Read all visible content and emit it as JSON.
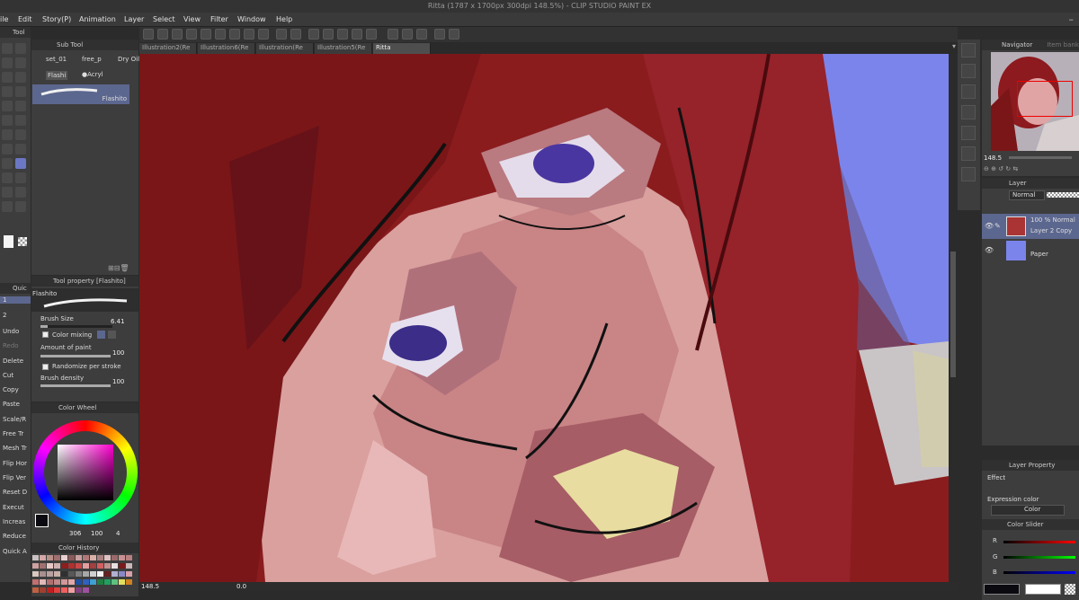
{
  "window_title": "Ritta (1787 x 1700px 300dpi 148.5%) - CLIP STUDIO PAINT EX",
  "menu": [
    "ile",
    "Edit",
    "Story(P)",
    "Animation",
    "Layer",
    "Select",
    "View",
    "Filter",
    "Window",
    "Help"
  ],
  "tool_panel": {
    "tab": "Tool"
  },
  "subtool_panel": {
    "tab": "Sub Tool",
    "groups": [
      "set_01",
      "free_p",
      "Dry Oil"
    ],
    "tabs": [
      "Flashi",
      "●Acryl"
    ],
    "active_brush": "Flashito"
  },
  "canvas_tabs": [
    "Illustration2(Re",
    "Illustration6(Re",
    "Illustration(Re",
    "Illustration5(Re",
    "Ritta"
  ],
  "active_tab": "Ritta",
  "quick_tab": "Quic",
  "quick_slots": [
    "1",
    "2"
  ],
  "commands": [
    "Undo",
    "Redo",
    "Delete",
    "Cut",
    "Copy",
    "Paste",
    "Scale/R",
    "Free Tr",
    "Mesh Tr",
    "Flip Hor",
    "Flip Ver",
    "Reset D",
    "Execut",
    "Increas",
    "Reduce",
    "Quick A"
  ],
  "tool_property": {
    "title": "Tool property [Flashito]",
    "brush_name": "Flashito",
    "brush_size_label": "Brush Size",
    "brush_size_value": "6.41",
    "color_mixing_label": "Color mixing",
    "amount_label": "Amount of paint",
    "amount_value": "100",
    "randomize_label": "Randomize per stroke",
    "density_label": "Brush density",
    "density_value": "100"
  },
  "color_wheel": {
    "title": "Color Wheel",
    "h": "306",
    "s": "100",
    "v": "4",
    "hue_color": "#ff00d0"
  },
  "color_history": {
    "title": "Color History",
    "swatches": [
      "#c9c2c0",
      "#d4a8a8",
      "#b8908a",
      "#a06e6e",
      "#e8d0d0",
      "#8a5a5a",
      "#c8a0a0",
      "#b07878",
      "#d8b0a8",
      "#a88080",
      "#e0c0c0",
      "#9a6a6a",
      "#c89090",
      "#b88080",
      "#d0a0a0",
      "#a07070",
      "#e8c8c8",
      "#d0b0b0",
      "#8a2020",
      "#b03030",
      "#c84848",
      "#e0a0a0",
      "#a04040",
      "#d06060",
      "#c09090",
      "#e8e0e0",
      "#7a1a1a",
      "#c8b8b8",
      "#d8c8c0",
      "#a89090",
      "#b8a0a0",
      "#c8b0a8",
      "#303030",
      "#585858",
      "#808080",
      "#a8a8a8",
      "#d0d0d0",
      "#f0f0f0",
      "#682020",
      "#b0b0d0",
      "#8888c8",
      "#d8a0a8",
      "#c07070",
      "#e0b8b8",
      "#b07070",
      "#c08888",
      "#d09898",
      "#e0a8a8",
      "#2050a0",
      "#3060c0",
      "#40a0d0",
      "#208040",
      "#20a060",
      "#60c080",
      "#e0e060",
      "#d08020",
      "#c06040",
      "#a04030",
      "#c02020",
      "#e04040",
      "#f06060",
      "#f0a0a0",
      "#804080",
      "#a050a0"
    ]
  },
  "zoom": "148.5",
  "status": {
    "zoom": "148.5",
    "angle": "0.0"
  },
  "navigator": {
    "title": "Navigator",
    "tab2": "Item bank",
    "zoom": "148.5"
  },
  "layer": {
    "title": "Layer",
    "blend": "Normal",
    "layers": [
      {
        "info": "100 % Normal",
        "name": "Layer 2 Copy"
      },
      {
        "info": "",
        "name": "Paper"
      }
    ]
  },
  "layer_property": {
    "title": "Layer Property",
    "effect": "Effect",
    "expression_label": "Expression color",
    "expression_value": "Color"
  },
  "color_slider": {
    "title": "Color Slider",
    "r": "R",
    "g": "G",
    "b": "B",
    "side": "RGB HSV CMY"
  },
  "colors": {
    "accent": "#6b77c4",
    "canvas_bg": "#7b84ea",
    "main_color": "#0a0a10",
    "r_track": "#c00000",
    "g_track": "#00c000",
    "b_track": "#0020c0"
  }
}
